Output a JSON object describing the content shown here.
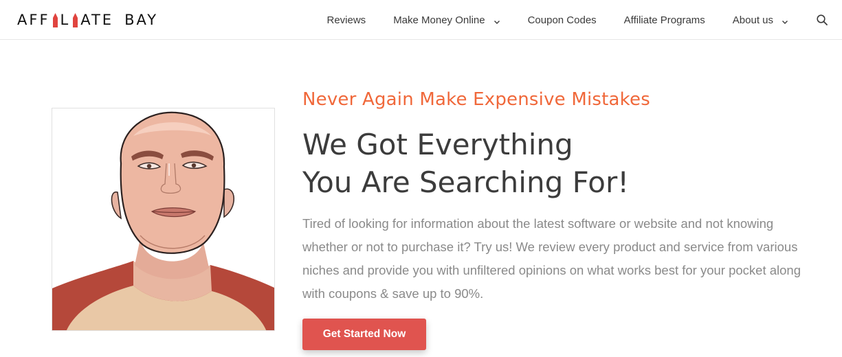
{
  "header": {
    "logo": {
      "part1": "AFF",
      "part2": "ATE",
      "part3": "BAY",
      "accent_color": "#e0443f"
    },
    "nav": [
      {
        "label": "Reviews",
        "has_dropdown": false
      },
      {
        "label": "Make Money Online",
        "has_dropdown": true
      },
      {
        "label": "Coupon Codes",
        "has_dropdown": false
      },
      {
        "label": "Affiliate Programs",
        "has_dropdown": false
      },
      {
        "label": "About us",
        "has_dropdown": true
      }
    ],
    "search_icon": "search-icon"
  },
  "hero": {
    "kicker": "Never Again Make Expensive Mistakes",
    "headline_line1": "We Got Everything",
    "headline_line2": "You Are Searching For!",
    "body": "Tired of looking for information about the latest software or website and not knowing whether or not to purchase it? Try us! We review every product and service from various niches and provide you with unfiltered opinions on what works best for your pocket along with coupons & save up to 90%.",
    "cta_label": "Get Started Now",
    "colors": {
      "kicker": "#f0683a",
      "cta": "#e0544f",
      "headline": "#3c3c3c",
      "body": "#8a8a8a"
    }
  }
}
